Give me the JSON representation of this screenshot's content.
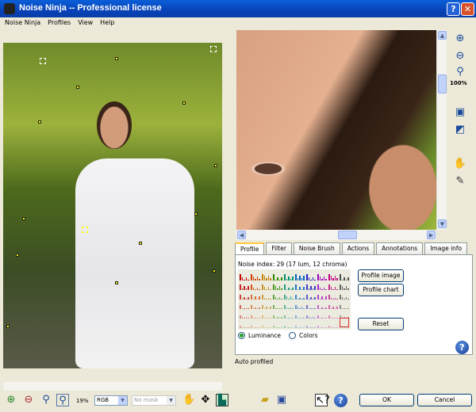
{
  "window": {
    "title": "Noise Ninja -- Professional license",
    "help_btn": "?",
    "close_btn": "✕"
  },
  "menu": [
    "Noise Ninja",
    "Profiles",
    "View",
    "Help"
  ],
  "right_toolbar": {
    "zoom_label": "100%"
  },
  "tabs": [
    "Profile",
    "Filter",
    "Noise Brush",
    "Actions",
    "Annotations",
    "Image info"
  ],
  "profile": {
    "noise_index": "Noise index:  29 (17 lum, 12 chroma)",
    "profile_image": "Profile image",
    "profile_chart": "Profile chart",
    "reset": "Reset",
    "luminance": "Luminance",
    "colors": "Colors",
    "selected_mode": "Luminance"
  },
  "status": "Auto profiled",
  "bottom": {
    "zoom": "19%",
    "channel": "RGB",
    "mask": "No mask",
    "ok": "OK",
    "cancel": "Cancel"
  },
  "chart_colors": [
    "#c00000",
    "#d04000",
    "#c08000",
    "#2a8a00",
    "#009070",
    "#0060c0",
    "#2020c0",
    "#a000c0",
    "#c00080",
    "#505050"
  ]
}
